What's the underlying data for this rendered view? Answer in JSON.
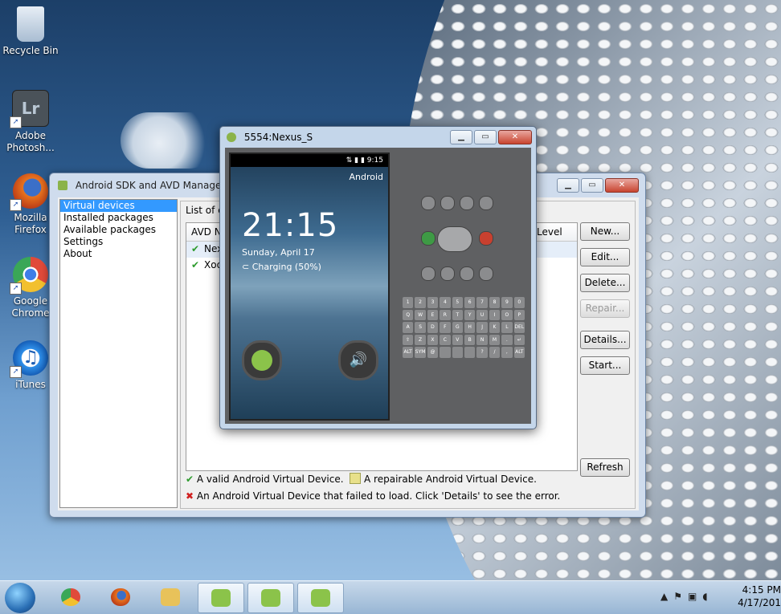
{
  "desktop": {
    "icons": [
      {
        "label": "Recycle Bin"
      },
      {
        "label": "Adobe Photosh..."
      },
      {
        "label": "Mozilla Firefox"
      },
      {
        "label": "Google Chrome"
      },
      {
        "label": "iTunes"
      }
    ],
    "lr_glyph": "Lr"
  },
  "sdk_window": {
    "title": "Android SDK and AVD Manager",
    "nav": [
      "Virtual devices",
      "Installed packages",
      "Available packages",
      "Settings",
      "About"
    ],
    "list_caption": "List of e",
    "table": {
      "col_name": "AVD N",
      "col_level": "Level",
      "rows": [
        {
          "name": "Nex",
          "status": "valid"
        },
        {
          "name": "Xoo",
          "status": "valid"
        }
      ]
    },
    "buttons": {
      "new": "New...",
      "edit": "Edit...",
      "delete": "Delete...",
      "repair": "Repair...",
      "details": "Details...",
      "start": "Start...",
      "refresh": "Refresh"
    },
    "legend": {
      "valid": "A valid Android Virtual Device.",
      "repairable": "A repairable Android Virtual Device.",
      "failed": "An Android Virtual Device that failed to load. Click 'Details' to see the error."
    }
  },
  "emulator": {
    "title": "5554:Nexus_S",
    "status_time": "9:15",
    "carrier": "Android",
    "clock": "21:15",
    "date": "Sunday, April 17",
    "charging": "Charging (50%)",
    "keyboard": [
      "1",
      "2",
      "3",
      "4",
      "5",
      "6",
      "7",
      "8",
      "9",
      "0",
      "Q",
      "W",
      "E",
      "R",
      "T",
      "Y",
      "U",
      "I",
      "O",
      "P",
      "A",
      "S",
      "D",
      "F",
      "G",
      "H",
      "J",
      "K",
      "L",
      "DEL",
      "⇧",
      "Z",
      "X",
      "C",
      "V",
      "B",
      "N",
      "M",
      ".",
      "↵",
      "ALT",
      "SYM",
      "@",
      "",
      "",
      "",
      "?",
      "/",
      ",",
      "ALT"
    ]
  },
  "taskbar": {
    "time": "4:15 PM",
    "date": "4/17/201",
    "colors": {
      "android": "#8bc34a",
      "chrome": "#e04a3a",
      "firefox": "#e8731e",
      "explorer": "#e8c25a"
    }
  }
}
